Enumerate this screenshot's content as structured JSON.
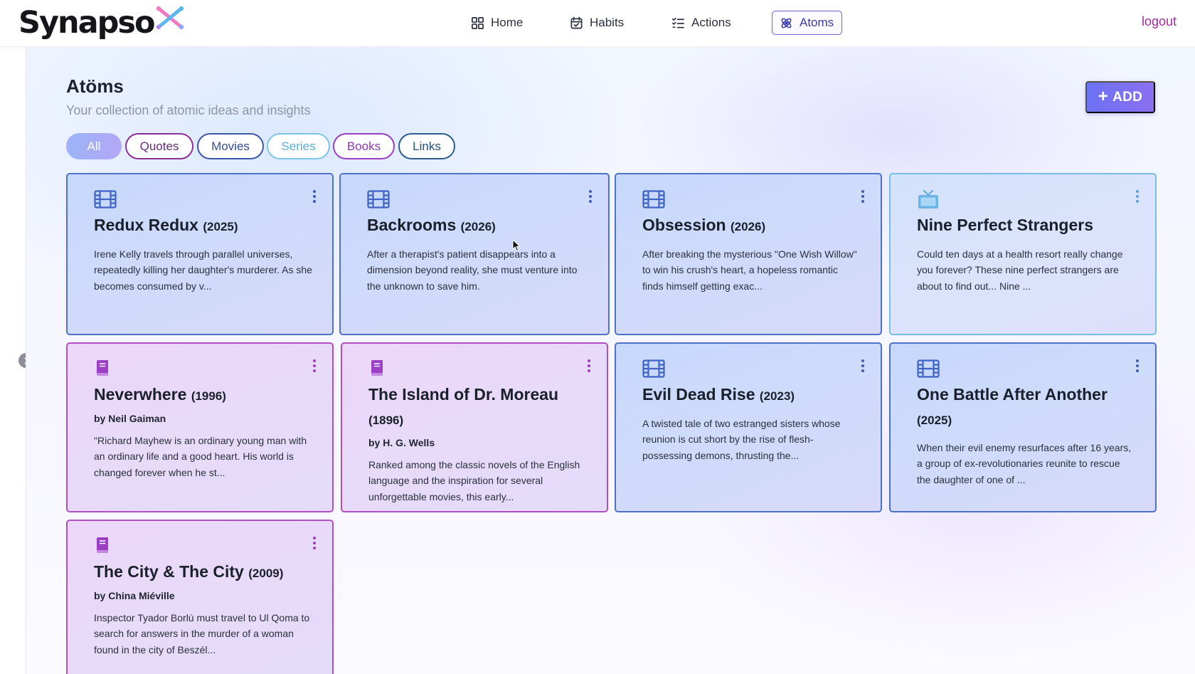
{
  "brand": {
    "name": "Synapso"
  },
  "nav": {
    "items": [
      {
        "label": "Home",
        "icon": "home-grid-icon"
      },
      {
        "label": "Habits",
        "icon": "calendar-check-icon"
      },
      {
        "label": "Actions",
        "icon": "checklist-icon"
      },
      {
        "label": "Atoms",
        "icon": "atom-icon",
        "active": true
      }
    ],
    "logout_label": "logout"
  },
  "page": {
    "title": "Atöms",
    "subtitle": "Your collection of atomic ideas and insights",
    "add_label": "ADD",
    "add_icon": "+"
  },
  "filters": [
    {
      "label": "All",
      "selected": true
    },
    {
      "label": "Quotes"
    },
    {
      "label": "Movies"
    },
    {
      "label": "Series"
    },
    {
      "label": "Books"
    },
    {
      "label": "Links"
    }
  ],
  "cards": [
    {
      "type": "movie",
      "icon": "film-icon",
      "title": "Redux Redux",
      "year": "(2025)",
      "author": "",
      "description": "Irene Kelly travels through parallel universes, repeatedly killing her daughter's murderer. As she becomes consumed by v..."
    },
    {
      "type": "movie",
      "icon": "film-icon",
      "title": "Backrooms",
      "year": "(2026)",
      "author": "",
      "description": "After a therapist's patient disappears into a dimension beyond reality, she must venture into the unknown to save him."
    },
    {
      "type": "movie",
      "icon": "film-icon",
      "title": "Obsession",
      "year": "(2026)",
      "author": "",
      "description": "After breaking the mysterious \"One Wish Willow\" to win his crush's heart, a hopeless romantic finds himself getting exac..."
    },
    {
      "type": "series",
      "icon": "tv-icon",
      "title": "Nine Perfect Strangers",
      "year": "",
      "author": "",
      "description": "Could ten days at a health resort really change you forever? These nine perfect strangers are about to find out... Nine ..."
    },
    {
      "type": "book",
      "icon": "book-icon",
      "title": "Neverwhere",
      "year": "(1996)",
      "author": "by Neil Gaiman",
      "description": "\"Richard Mayhew is an ordinary young man with an ordinary life and a good heart. His world is changed forever when he st..."
    },
    {
      "type": "book",
      "icon": "book-icon",
      "title": "The Island of Dr. Moreau",
      "year": "(1896)",
      "author": "by H. G. Wells",
      "description": "Ranked among the classic novels of the English language and the inspiration for several unforgettable movies, this early..."
    },
    {
      "type": "movie",
      "icon": "film-icon",
      "title": "Evil Dead Rise",
      "year": "(2023)",
      "author": "",
      "description": "A twisted tale of two estranged sisters whose reunion is cut short by the rise of flesh-possessing demons, thrusting the..."
    },
    {
      "type": "movie",
      "icon": "film-icon",
      "title": "One Battle After Another",
      "year": "(2025)",
      "author": "",
      "description": "When their evil enemy resurfaces after 16 years, a group of ex-revolutionaries reunite to rescue the daughter of one of ..."
    },
    {
      "type": "book",
      "icon": "book-icon",
      "title": "The City & The City",
      "year": "(2009)",
      "author": "by China Miéville",
      "description": "Inspector Tyador Borlú must travel to Ul Qoma to search for answers in the murder of a woman found in the city of Beszél..."
    }
  ],
  "colors": {
    "accent": "#6b73f2",
    "logout": "#a12b9d",
    "movie_border": "#4e72c8",
    "series_border": "#76bde8",
    "book_border": "#b14fc2"
  }
}
